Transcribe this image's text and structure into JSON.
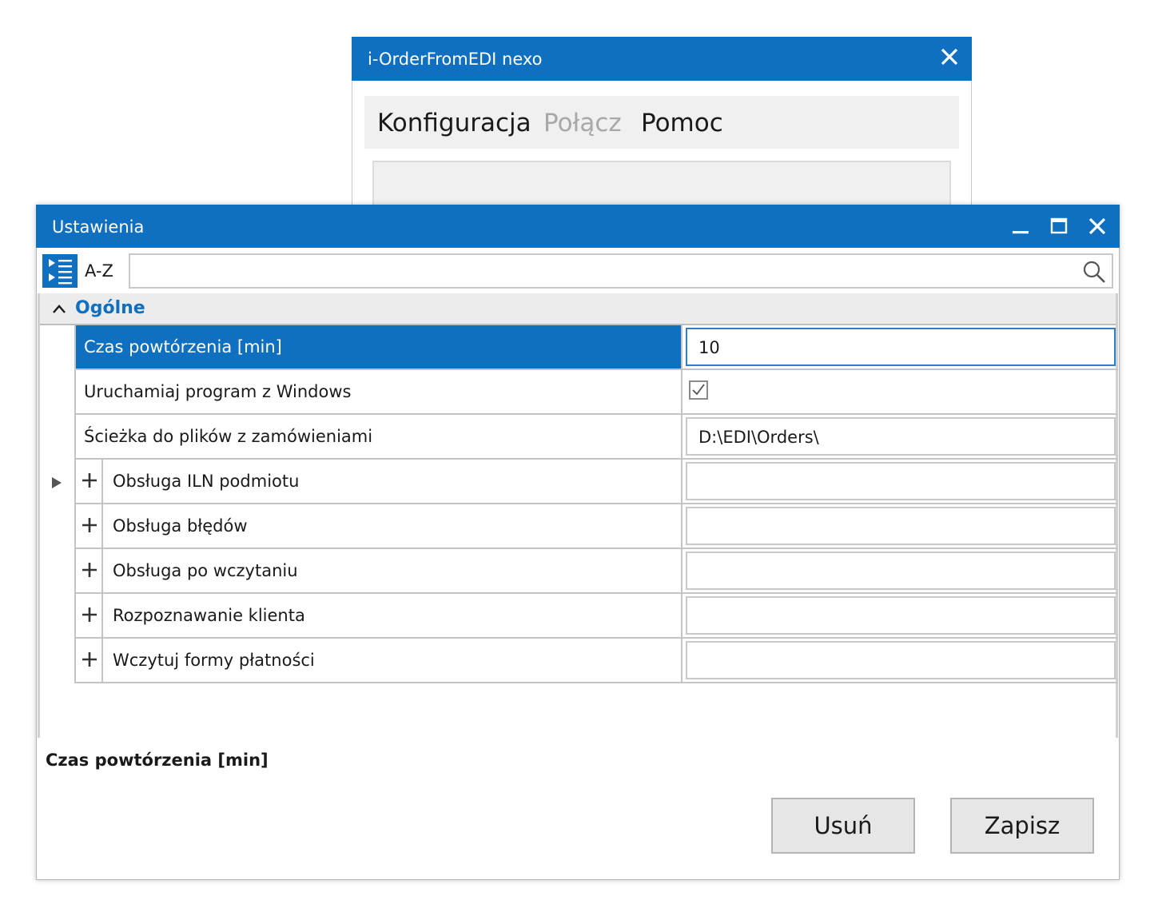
{
  "main_window": {
    "title": "i-OrderFromEDI nexo",
    "menu": {
      "konfiguracja": "Konfiguracja",
      "polacz": "Połącz",
      "pomoc": "Pomoc"
    }
  },
  "settings": {
    "title": "Ustawienia",
    "toolbar": {
      "az_label": "A-Z",
      "search_value": ""
    },
    "category": {
      "label": "Ogólne"
    },
    "rows": [
      {
        "label": "Czas powtórzenia [min]",
        "value": "10"
      },
      {
        "label": "Uruchamiaj program z Windows",
        "checked": true
      },
      {
        "label": "Ścieżka do plików z zamówieniami",
        "value": "D:\\EDI\\Orders\\"
      },
      {
        "label": "Obsługa ILN podmiotu",
        "value": ""
      },
      {
        "label": "Obsługa błędów",
        "value": ""
      },
      {
        "label": "Obsługa po wczytaniu",
        "value": ""
      },
      {
        "label": "Rozpoznawanie klienta",
        "value": ""
      },
      {
        "label": "Wczytuj formy płatności",
        "value": ""
      }
    ],
    "description": "Czas powtórzenia [min]",
    "buttons": {
      "delete": "Usuń",
      "save": "Zapisz"
    }
  },
  "colors": {
    "accent": "#0f6fc0",
    "menu_disabled": "#a8a8a8"
  },
  "icons": [
    "close-icon",
    "minimize-icon",
    "maximize-icon",
    "categorized-view-icon",
    "search-icon",
    "collapse-chevron-icon",
    "expand-plus-icon",
    "row-pointer-icon",
    "checkmark-icon"
  ]
}
